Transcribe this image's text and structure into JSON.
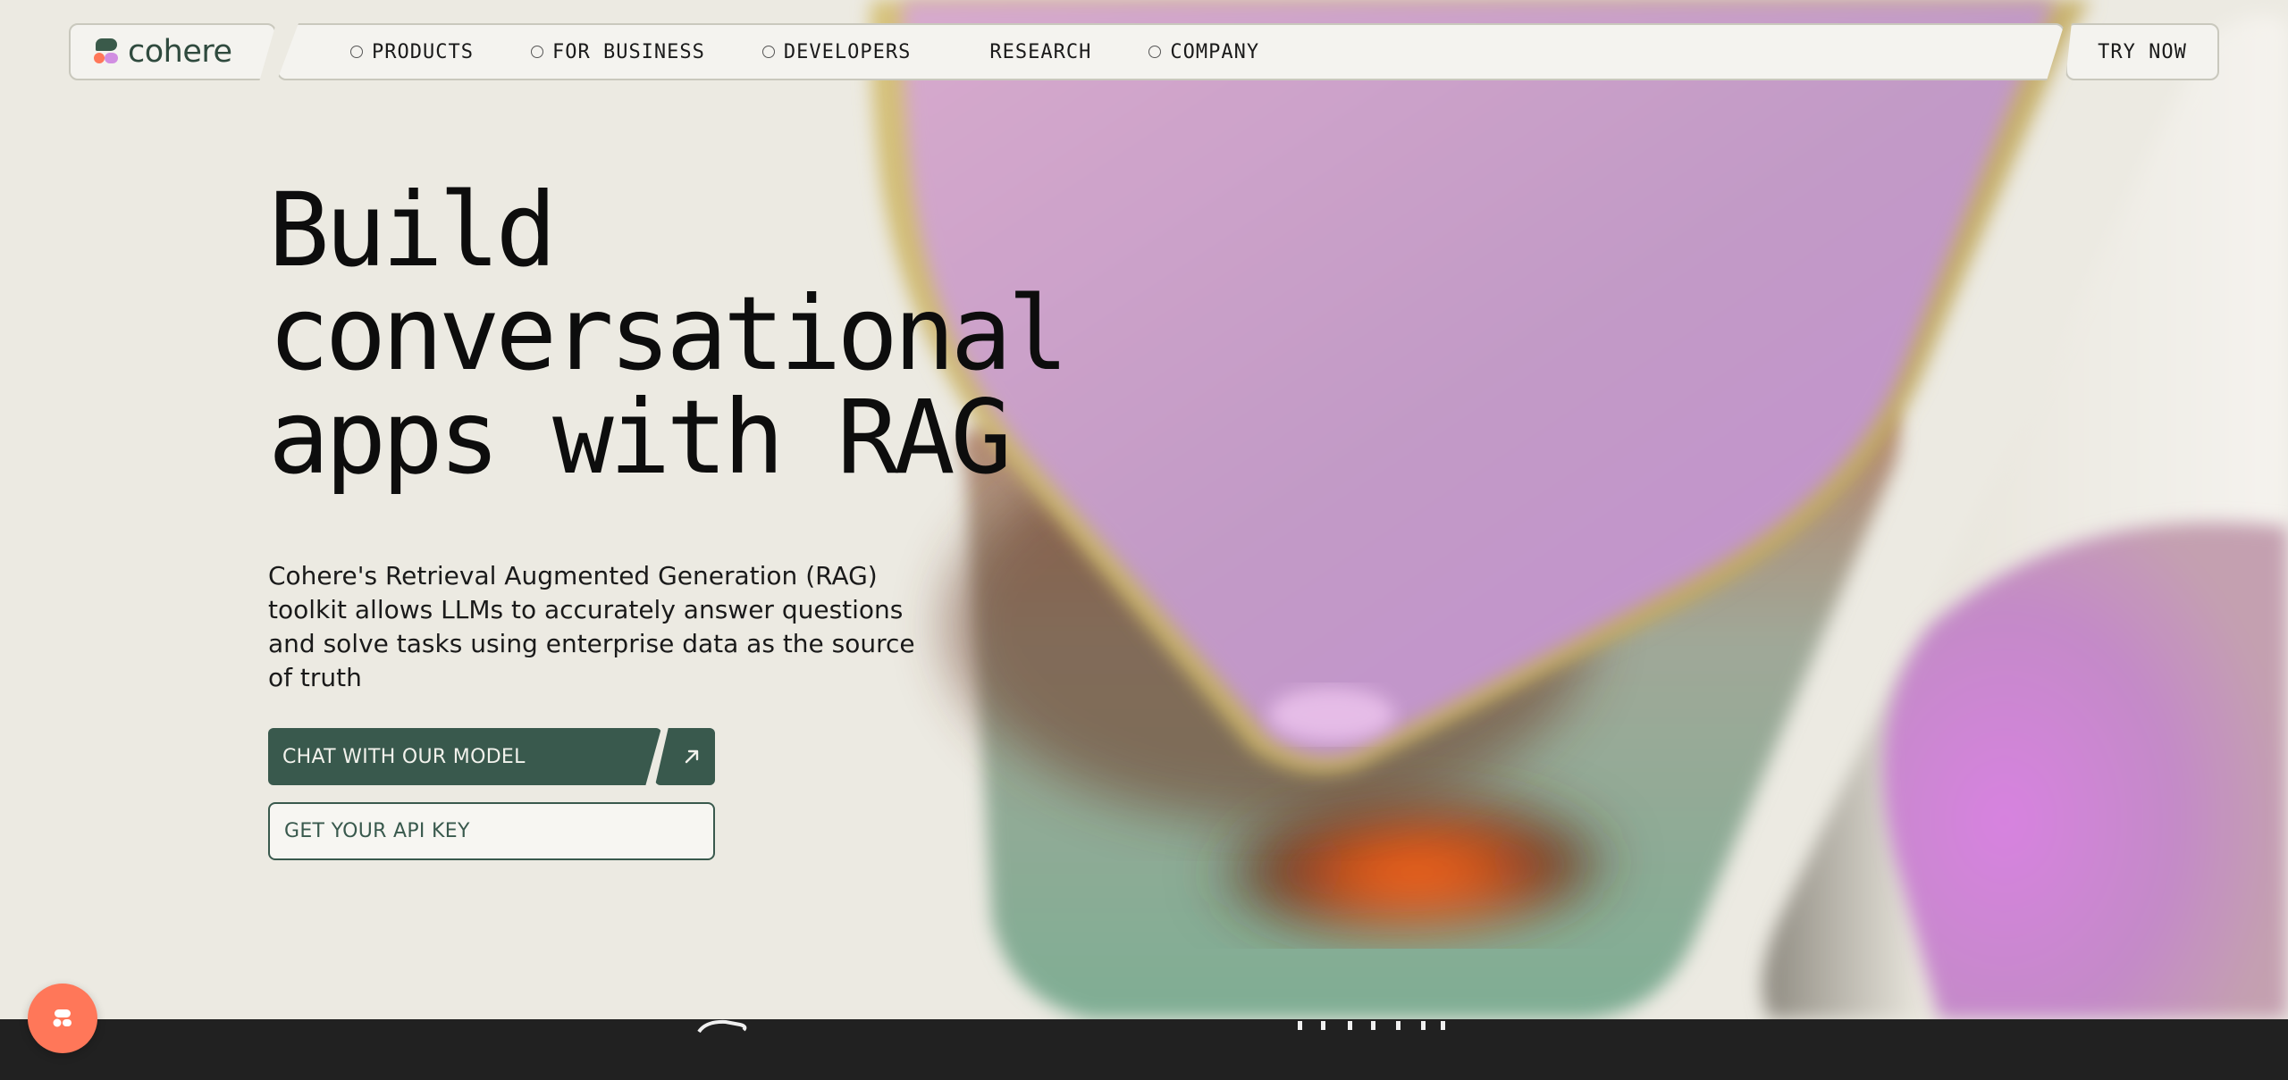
{
  "brand": {
    "name": "cohere",
    "colors": {
      "primary": "#39594d",
      "accent": "#ff7759",
      "lavender": "#d18ee2",
      "background": "#eceae2"
    }
  },
  "header": {
    "nav": [
      {
        "label": "PRODUCTS",
        "has_dot": true
      },
      {
        "label": "FOR BUSINESS",
        "has_dot": true
      },
      {
        "label": "DEVELOPERS",
        "has_dot": true
      },
      {
        "label": "RESEARCH",
        "has_dot": false
      },
      {
        "label": "COMPANY",
        "has_dot": true
      }
    ],
    "cta": "TRY NOW"
  },
  "hero": {
    "title_lines": [
      "Build",
      "conversational",
      "apps with RAG"
    ],
    "description": "Cohere's Retrieval Augmented Generation (RAG) toolkit allows LLMs to accurately answer questions and solve tasks using enterprise data as the source of truth",
    "primary_button": "CHAT WITH OUR MODEL",
    "arrow_icon": "arrow-up-right-icon",
    "secondary_button": "GET YOUR API KEY"
  },
  "chat_widget": {
    "icon": "cohere-chat-icon"
  }
}
